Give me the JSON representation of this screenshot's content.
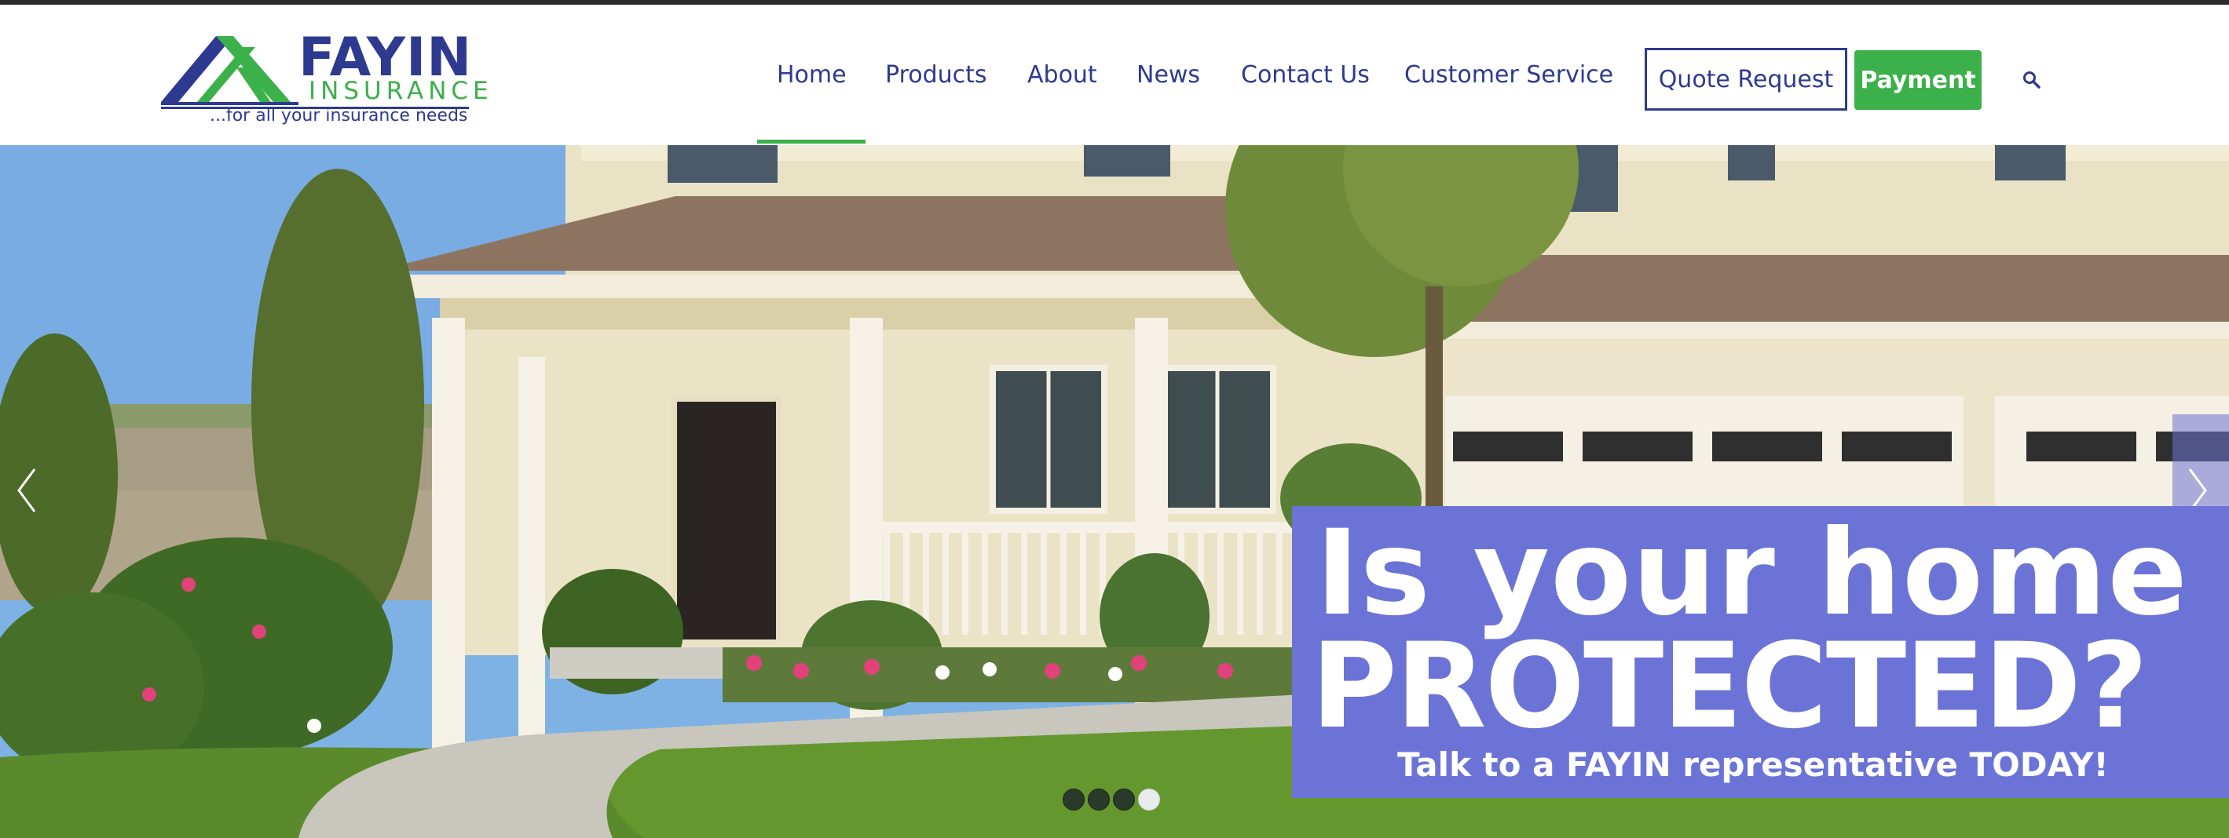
{
  "brand": {
    "name": "FAYIN",
    "sub": "INSURANCE",
    "tagline": "...for all your insurance needs",
    "colors": {
      "primary": "#2e3a8f",
      "accent": "#3cb04a"
    }
  },
  "nav": {
    "items": [
      {
        "label": "Home",
        "active": true
      },
      {
        "label": "Products"
      },
      {
        "label": "About"
      },
      {
        "label": "News"
      },
      {
        "label": "Contact Us"
      },
      {
        "label": "Customer Service"
      }
    ],
    "quote_label": "Quote Request",
    "payment_label": "Payment",
    "search_icon": "search-icon"
  },
  "hero": {
    "headline_line1": "Is your home",
    "headline_line2": "PROTECTED?",
    "subline": "Talk to a FAYIN representative TODAY!",
    "banner_color": "#6b74d6",
    "slides_total": 4,
    "active_slide": 4
  }
}
